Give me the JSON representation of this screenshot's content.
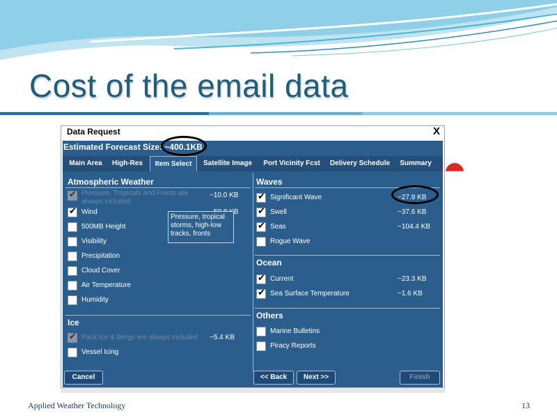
{
  "slide": {
    "title": "Cost of the email data",
    "footer_left": "Applied Weather Technology",
    "footer_right": "13"
  },
  "dialog": {
    "title": "Data Request",
    "close_label": "X",
    "estimated_label": "Estimated Forecast Size:",
    "estimated_value": "~400.1KB",
    "tabs": [
      "Main Area",
      "High-Res",
      "Item Select",
      "Satellite Image",
      "Port Vicinity Fcst",
      "Delivery Schedule",
      "Summary"
    ],
    "active_tab": "Item Select",
    "atmospheric": {
      "title": "Atmospheric Weather",
      "items": [
        {
          "label": "Pressure, Tropicals and Fronts are always included",
          "size": "~10.0 KB",
          "checked": true,
          "disabled": true
        },
        {
          "label": "Wind",
          "size": "~50.8 KB",
          "checked": true,
          "disabled": false
        },
        {
          "label": "500MB Height",
          "size": "",
          "checked": false,
          "disabled": false
        },
        {
          "label": "Visibility",
          "size": "",
          "checked": false,
          "disabled": false
        },
        {
          "label": "Precipitation",
          "size": "",
          "checked": false,
          "disabled": false
        },
        {
          "label": "Cloud Cover",
          "size": "",
          "checked": false,
          "disabled": false
        },
        {
          "label": "Air Temperature",
          "size": "",
          "checked": false,
          "disabled": false
        },
        {
          "label": "Humidity",
          "size": "",
          "checked": false,
          "disabled": false
        }
      ]
    },
    "tooltip": "Pressure, tropical storms, high-low tracks, fronts",
    "ice": {
      "title": "Ice",
      "items": [
        {
          "label": "Pack Ice & Bergs are always included",
          "size": "~5.4 KB",
          "checked": true,
          "disabled": true
        },
        {
          "label": "Vessel Icing",
          "size": "",
          "checked": false,
          "disabled": false
        }
      ]
    },
    "waves": {
      "title": "Waves",
      "items": [
        {
          "label": "Significant Wave",
          "size": "~27.9 KB",
          "checked": true
        },
        {
          "label": "Swell",
          "size": "~37.6 KB",
          "checked": true
        },
        {
          "label": "Seas",
          "size": "~104.4 KB",
          "checked": true
        },
        {
          "label": "Rogue Wave",
          "size": "",
          "checked": false
        }
      ]
    },
    "ocean": {
      "title": "Ocean",
      "items": [
        {
          "label": "Current",
          "size": "~23.3 KB",
          "checked": true
        },
        {
          "label": "Sea Surface Temperature",
          "size": "~1.6 KB",
          "checked": true
        }
      ]
    },
    "others": {
      "title": "Others",
      "items": [
        {
          "label": "Marine Bulletins",
          "size": "",
          "checked": false
        },
        {
          "label": "Piracy Reports",
          "size": "",
          "checked": false
        }
      ]
    },
    "buttons": {
      "cancel": "Cancel",
      "back": "<< Back",
      "next": "Next >>",
      "finish": "Finish"
    }
  },
  "colors": {
    "panel": "#2c5e8d",
    "title_text": "#1f5e7a",
    "annotation_ring": "#000000"
  }
}
